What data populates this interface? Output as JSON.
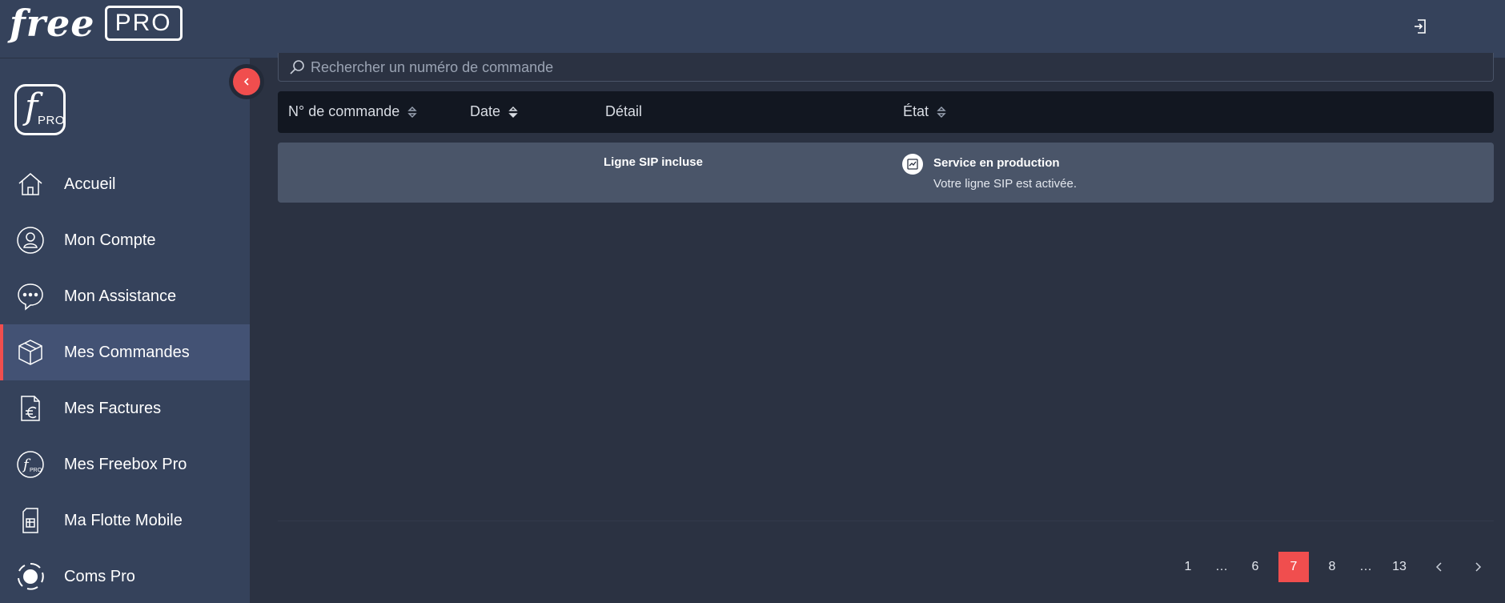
{
  "header": {
    "brand_name": "free",
    "brand_badge": "PRO",
    "logout_icon": "logout-icon"
  },
  "sidebar": {
    "logo": {
      "letter": "f",
      "sub": "PRO"
    },
    "collapse_icon": "chevron-left-icon",
    "items": [
      {
        "label": "Accueil",
        "icon": "home-icon",
        "active": false
      },
      {
        "label": "Mon Compte",
        "icon": "user-icon",
        "active": false
      },
      {
        "label": "Mon Assistance",
        "icon": "chat-bubble-icon",
        "active": false
      },
      {
        "label": "Mes Commandes",
        "icon": "package-icon",
        "active": true
      },
      {
        "label": "Mes Factures",
        "icon": "invoice-euro-icon",
        "active": false
      },
      {
        "label": "Mes Freebox Pro",
        "icon": "freebox-pro-icon",
        "active": false
      },
      {
        "label": "Ma Flotte Mobile",
        "icon": "sim-card-icon",
        "active": false
      },
      {
        "label": "Coms Pro",
        "icon": "coms-pro-icon",
        "active": false
      }
    ]
  },
  "search": {
    "placeholder": "Rechercher un numéro de commande",
    "value": ""
  },
  "table": {
    "columns": [
      "N° de commande",
      "Date",
      "Détail",
      "État"
    ],
    "rows": [
      {
        "order_number": "",
        "date": "",
        "detail": "Ligne SIP incluse",
        "status_title": "Service en production",
        "status_desc": "Votre ligne SIP est activée."
      }
    ]
  },
  "pagination": {
    "pages": [
      "1",
      "…",
      "6",
      "7",
      "8",
      "…",
      "13"
    ],
    "current": "7"
  },
  "colors": {
    "accent": "#f04e4e",
    "sidebar_bg": "#35425b",
    "content_bg": "#2b3242",
    "table_header_bg": "#121721",
    "row_bg": "#4a5569"
  }
}
